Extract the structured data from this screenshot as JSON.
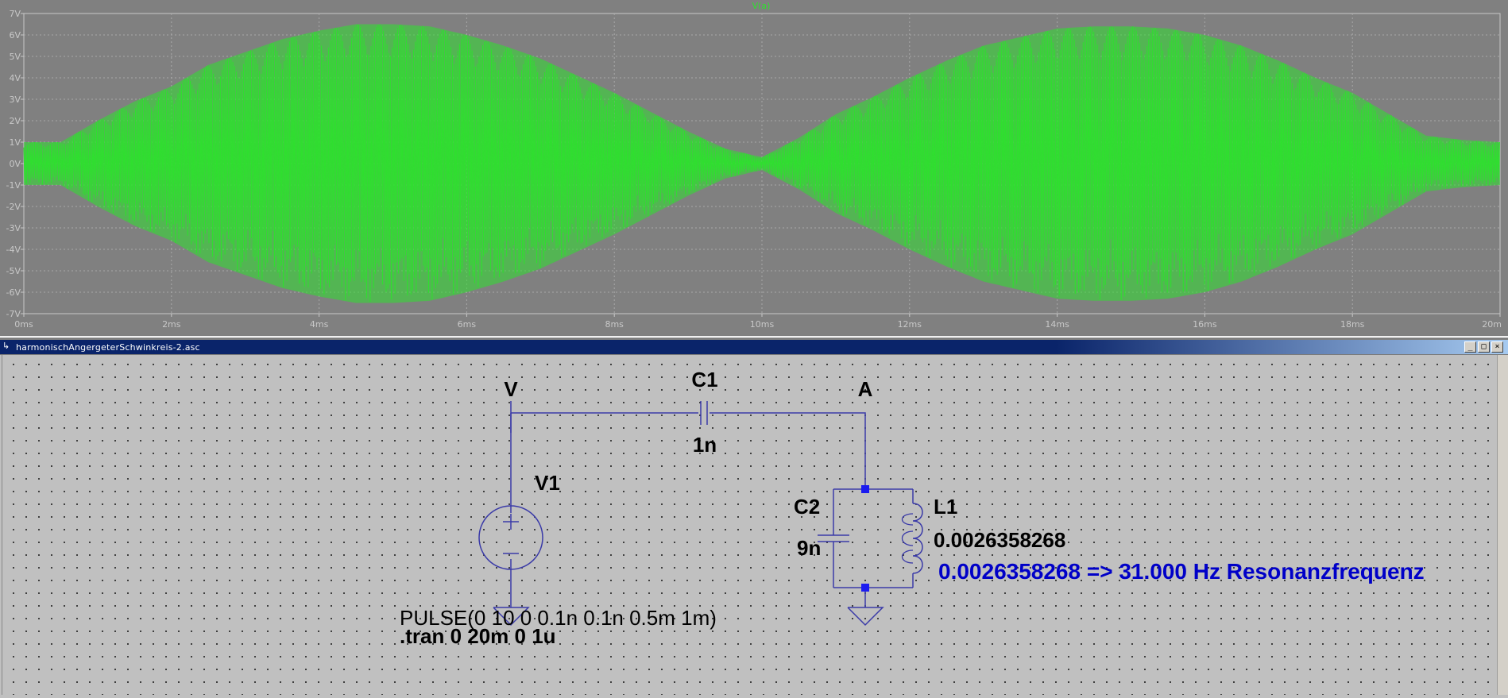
{
  "plot": {
    "trace_name": "V(a)",
    "y_ticks": [
      "7V",
      "6V",
      "5V",
      "4V",
      "3V",
      "2V",
      "1V",
      "0V",
      "-1V",
      "-2V",
      "-3V",
      "-4V",
      "-5V",
      "-6V",
      "-7V"
    ],
    "x_ticks": [
      "0ms",
      "2ms",
      "4ms",
      "6ms",
      "8ms",
      "10ms",
      "12ms",
      "14ms",
      "16ms",
      "18ms",
      "20m"
    ],
    "trace_color": "#2ee02e",
    "background_color": "#808080"
  },
  "chart_data": {
    "type": "line",
    "title": "V(a)",
    "xlabel": "",
    "ylabel": "",
    "xlim": [
      0,
      20
    ],
    "ylim": [
      -7,
      7
    ],
    "x_unit": "ms",
    "y_unit": "V",
    "grid": true,
    "series": [
      {
        "name": "V(a)",
        "envelope_x_ms": [
          0,
          0.5,
          1,
          1.5,
          2,
          2.5,
          3,
          3.5,
          4,
          4.5,
          5,
          5.5,
          6,
          6.5,
          7,
          7.5,
          8,
          8.5,
          9,
          9.5,
          10,
          10.5,
          11,
          11.5,
          12,
          12.5,
          13,
          13.5,
          14,
          14.5,
          15,
          15.5,
          16,
          16.5,
          17,
          17.5,
          18,
          18.5,
          19,
          19.5,
          20
        ],
        "envelope_amplitude_v": [
          1.0,
          1.0,
          2.0,
          2.9,
          3.6,
          4.6,
          5.2,
          5.8,
          6.2,
          6.5,
          6.5,
          6.4,
          6.0,
          5.5,
          4.9,
          4.1,
          3.3,
          2.4,
          1.5,
          0.7,
          0.3,
          1.2,
          2.3,
          3.1,
          4.0,
          4.8,
          5.5,
          5.9,
          6.3,
          6.4,
          6.4,
          6.3,
          6.0,
          5.5,
          4.8,
          4.0,
          3.3,
          2.3,
          1.3,
          1.1,
          1.0
        ]
      }
    ]
  },
  "window": {
    "title": "harmonischAngergeterSchwinkreis-2.asc",
    "buttons": [
      "_",
      "□",
      "×"
    ]
  },
  "schematic": {
    "node_v": "V",
    "node_a": "A",
    "c1_name": "C1",
    "c1_value": "1n",
    "v1_name": "V1",
    "c2_name": "C2",
    "c2_value": "9n",
    "l1_name": "L1",
    "l1_value": "0.0026358268",
    "comment": "0.0026358268 => 31.000 Hz Resonanzfrequenz",
    "comment_color": "#0000c8",
    "v1_value": "PULSE(0 10 0 0.1n 0.1n 0.5m 1m)",
    "directive": ".tran 0 20m 0 1u",
    "wire_color": "#3a3aa8"
  }
}
